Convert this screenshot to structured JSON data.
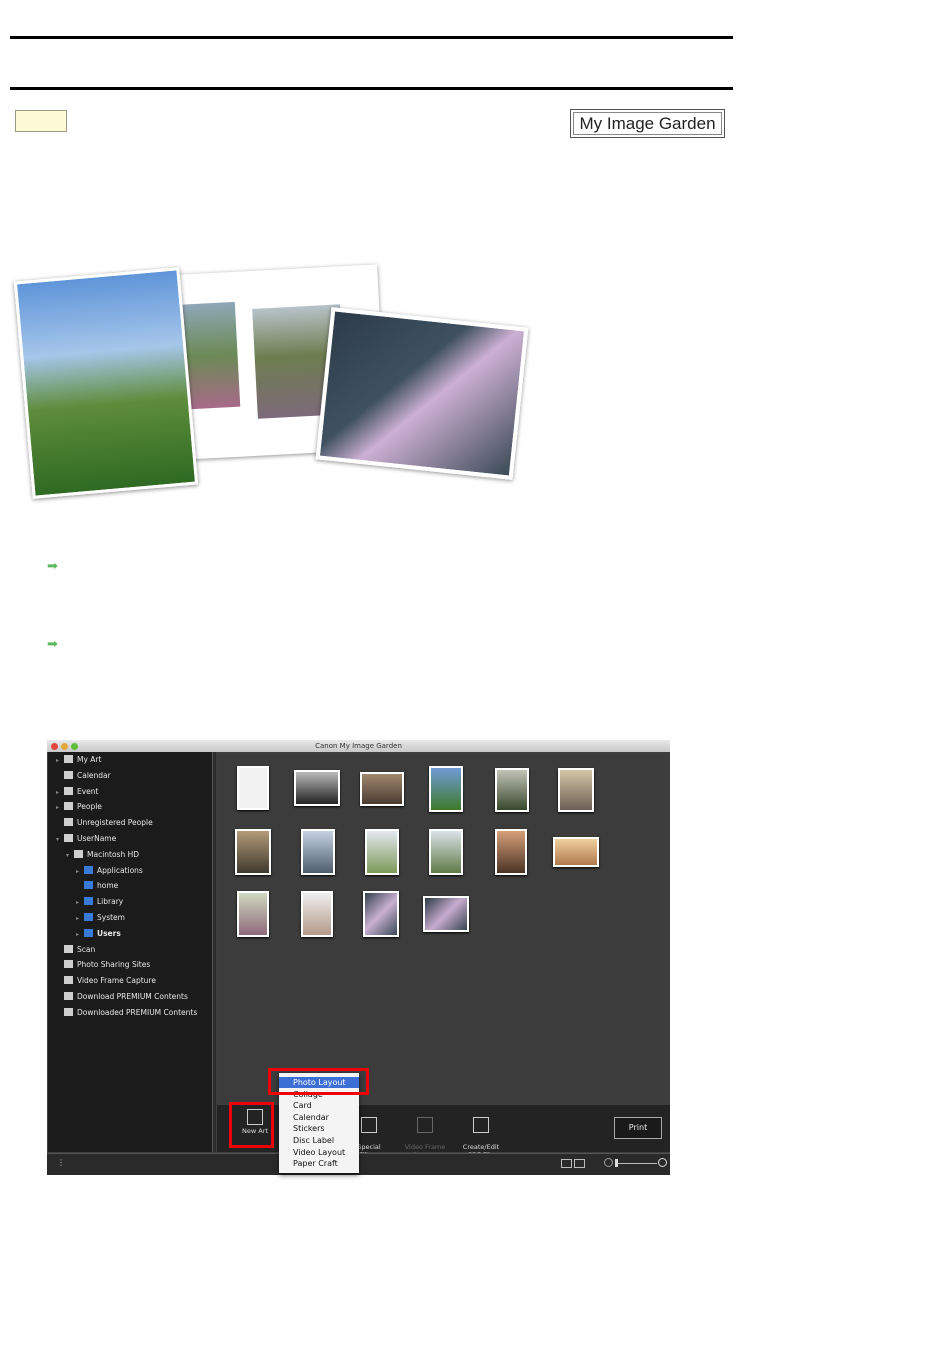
{
  "header": {
    "brand": "My Image Garden"
  },
  "app": {
    "title": "Canon My Image Garden",
    "sidebar": [
      {
        "label": "My Art",
        "level": 0,
        "arrow": "▸",
        "bold": false
      },
      {
        "label": "Calendar",
        "level": 0,
        "arrow": "",
        "bold": false
      },
      {
        "label": "Event",
        "level": 0,
        "arrow": "▸",
        "bold": false
      },
      {
        "label": "People",
        "level": 0,
        "arrow": "▸",
        "bold": false
      },
      {
        "label": "Unregistered People",
        "level": 0,
        "arrow": "",
        "bold": false
      },
      {
        "label": "UserName",
        "level": 0,
        "arrow": "▾",
        "bold": false
      },
      {
        "label": "Macintosh HD",
        "level": 1,
        "arrow": "▾",
        "bold": false
      },
      {
        "label": "Applications",
        "level": 2,
        "arrow": "▸",
        "bold": false
      },
      {
        "label": "home",
        "level": 2,
        "arrow": "",
        "bold": false
      },
      {
        "label": "Library",
        "level": 2,
        "arrow": "▸",
        "bold": false
      },
      {
        "label": "System",
        "level": 2,
        "arrow": "▸",
        "bold": false
      },
      {
        "label": "Users",
        "level": 2,
        "arrow": "▸",
        "bold": true
      },
      {
        "label": "Scan",
        "level": 0,
        "arrow": "",
        "bold": false
      },
      {
        "label": "Photo Sharing Sites",
        "level": 0,
        "arrow": "",
        "bold": false
      },
      {
        "label": "Video Frame Capture",
        "level": 0,
        "arrow": "",
        "bold": false
      },
      {
        "label": "Download PREMIUM Contents",
        "level": 0,
        "arrow": "",
        "bold": false
      },
      {
        "label": "Downloaded PREMIUM Contents",
        "level": 0,
        "arrow": "",
        "bold": false
      }
    ],
    "toolbar": {
      "new_art": "New Art",
      "special_filters": "Special\nFilters",
      "video_frame_capture": "Video Frame\nCapture",
      "create_edit_pdf": "Create/Edit\nPDF File",
      "print": "Print"
    },
    "new_art_menu": [
      "Photo Layout",
      "Collage",
      "Card",
      "Calendar",
      "Stickers",
      "Disc Label",
      "Video Layout",
      "Paper Craft"
    ],
    "selected_menu_item": "Photo Layout"
  },
  "colors": {
    "highlight_box": "#fdfbd7",
    "arrow": "#5cb85c",
    "menu_selection": "#3b6fd6",
    "callout": "#e00000"
  }
}
